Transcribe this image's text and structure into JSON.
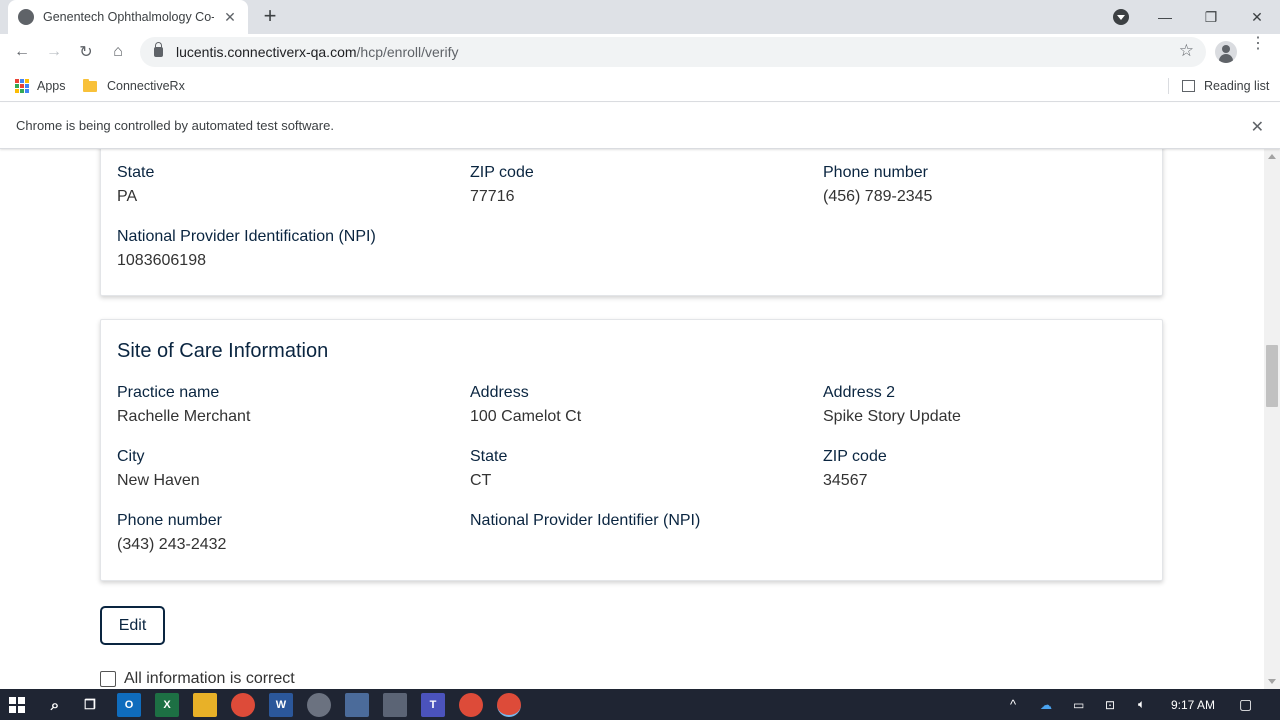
{
  "browser": {
    "tab_title": "Genentech Ophthalmology Co-p",
    "url_host": "lucentis.connectiverx-qa.com",
    "url_path": "/hcp/enroll/verify",
    "bookmarks": [
      {
        "label": "Apps"
      },
      {
        "label": "ConnectiveRx"
      }
    ],
    "reading_list": "Reading list",
    "infobar_text": "Chrome is being controlled by automated test software."
  },
  "provider_card": {
    "fields": [
      {
        "label": "State",
        "value": "PA"
      },
      {
        "label": "ZIP code",
        "value": "77716"
      },
      {
        "label": "Phone number",
        "value": "(456) 789-2345"
      },
      {
        "label": "National Provider Identification (NPI)",
        "value": "1083606198"
      }
    ]
  },
  "site_of_care": {
    "title": "Site of Care Information",
    "fields": [
      {
        "label": "Practice name",
        "value": "Rachelle Merchant"
      },
      {
        "label": "Address",
        "value": "100 Camelot Ct"
      },
      {
        "label": "Address 2",
        "value": "Spike Story Update"
      },
      {
        "label": "City",
        "value": "New Haven"
      },
      {
        "label": "State",
        "value": "CT"
      },
      {
        "label": "ZIP code",
        "value": "34567"
      },
      {
        "label": "Phone number",
        "value": "(343) 243-2432"
      },
      {
        "label": "National Provider Identifier (NPI)",
        "value": ""
      }
    ]
  },
  "actions": {
    "edit_label": "Edit",
    "confirm_label": "All information is correct",
    "confirm_checked": false
  },
  "taskbar": {
    "time": "9:17 AM",
    "pinned": [
      "windows-start",
      "search",
      "task-view",
      "outlook",
      "excel",
      "chrome",
      "file-explorer",
      "chrome",
      "word",
      "app",
      "app",
      "app",
      "teams",
      "chrome",
      "chrome"
    ]
  },
  "colors": {
    "heading": "#0a2540",
    "accent_blue": "#1a73e8"
  }
}
